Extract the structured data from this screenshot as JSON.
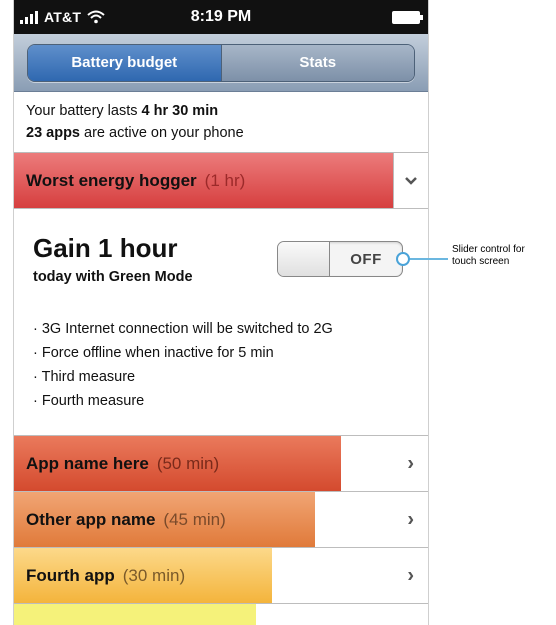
{
  "status_bar": {
    "carrier": "AT&T",
    "time": "8:19 PM"
  },
  "tabs": [
    {
      "label": "Battery budget",
      "active": true
    },
    {
      "label": "Stats",
      "active": false
    }
  ],
  "summary": {
    "line1_prefix": "Your battery lasts ",
    "line1_value": "4 hr 30 min",
    "line2_value": "23 apps",
    "line2_suffix": " are active on your phone"
  },
  "hogger": {
    "title": "Worst energy hogger",
    "duration": "(1 hr)"
  },
  "green_mode": {
    "headline": "Gain 1 hour",
    "subline": "today with Green Mode",
    "toggle_state": "OFF",
    "measures": [
      "3G Internet connection will be switched to 2G",
      "Force offline when inactive for 5 min",
      "Third measure",
      "Fourth measure"
    ]
  },
  "apps": [
    {
      "name": "App name here",
      "duration": "(50 min)"
    },
    {
      "name": "Other app name",
      "duration": "(45 min)"
    },
    {
      "name": "Fourth app",
      "duration": "(30 min)"
    },
    {
      "name": "",
      "duration": ""
    }
  ],
  "annotation": {
    "text_line1": "Slider control for",
    "text_line2": "touch screen"
  },
  "colors": {
    "hogger": "#d63f3f",
    "app1": "#d44a2e",
    "app2": "#e07a3a",
    "app3": "#f4b43c",
    "app4": "#f5f27a",
    "tab_active": "#2f68b0"
  }
}
